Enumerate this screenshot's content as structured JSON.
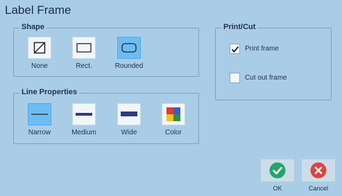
{
  "dialog": {
    "title": "Label Frame"
  },
  "shape": {
    "heading": "Shape",
    "options": [
      {
        "label": "None",
        "icon": "no-frame-icon",
        "selected": false
      },
      {
        "label": "Rect.",
        "icon": "rectangle-frame-icon",
        "selected": false
      },
      {
        "label": "Rounded",
        "icon": "rounded-frame-icon",
        "selected": true
      }
    ]
  },
  "line": {
    "heading": "Line Properties",
    "options": [
      {
        "label": "Narrow",
        "icon": "narrow-line-icon",
        "selected": true
      },
      {
        "label": "Medium",
        "icon": "medium-line-icon",
        "selected": false
      },
      {
        "label": "Wide",
        "icon": "wide-line-icon",
        "selected": false
      },
      {
        "label": "Color",
        "icon": "color-palette-icon",
        "selected": false
      }
    ]
  },
  "print_cut": {
    "heading": "Print/Cut",
    "print_frame": {
      "label": "Print frame",
      "checked": true
    },
    "cut_out_frame": {
      "label": "Cut out frame",
      "checked": false
    }
  },
  "actions": {
    "ok_label": "OK",
    "cancel_label": "Cancel"
  },
  "colors": {
    "background": "#a9cde7",
    "selected": "#6dbcf4",
    "ok_green": "#27a36b",
    "cancel_red": "#d9473f"
  }
}
